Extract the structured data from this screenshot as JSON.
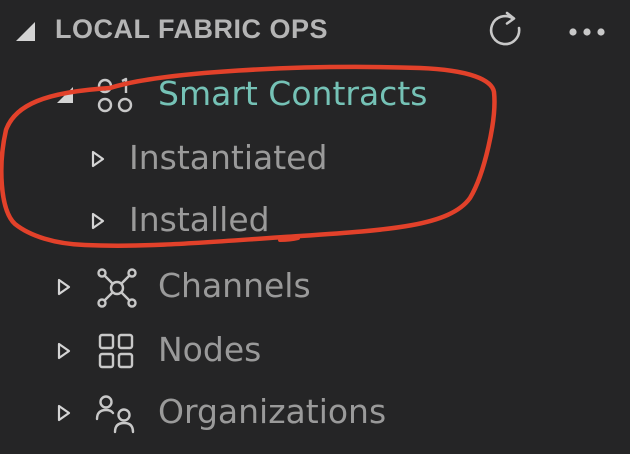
{
  "panel": {
    "title": "LOCAL FABRIC OPS",
    "refresh_icon": "refresh-icon",
    "more_icon": "more-actions-icon"
  },
  "tree": {
    "smart_contracts": {
      "label": "Smart Contracts",
      "expanded": true,
      "icon": "smart-contract-icon",
      "color": "#75c2b6"
    },
    "instantiated": {
      "label": "Instantiated",
      "expanded": false
    },
    "installed": {
      "label": "Installed",
      "expanded": false
    },
    "channels": {
      "label": "Channels",
      "expanded": false,
      "icon": "channels-icon"
    },
    "nodes": {
      "label": "Nodes",
      "expanded": false,
      "icon": "nodes-icon"
    },
    "organizations": {
      "label": "Organizations",
      "expanded": false,
      "icon": "organizations-icon"
    }
  },
  "colors": {
    "background": "#252526",
    "label": "#9a9a9a",
    "highlight": "#75c2b6",
    "annotation": "#e2412a"
  }
}
